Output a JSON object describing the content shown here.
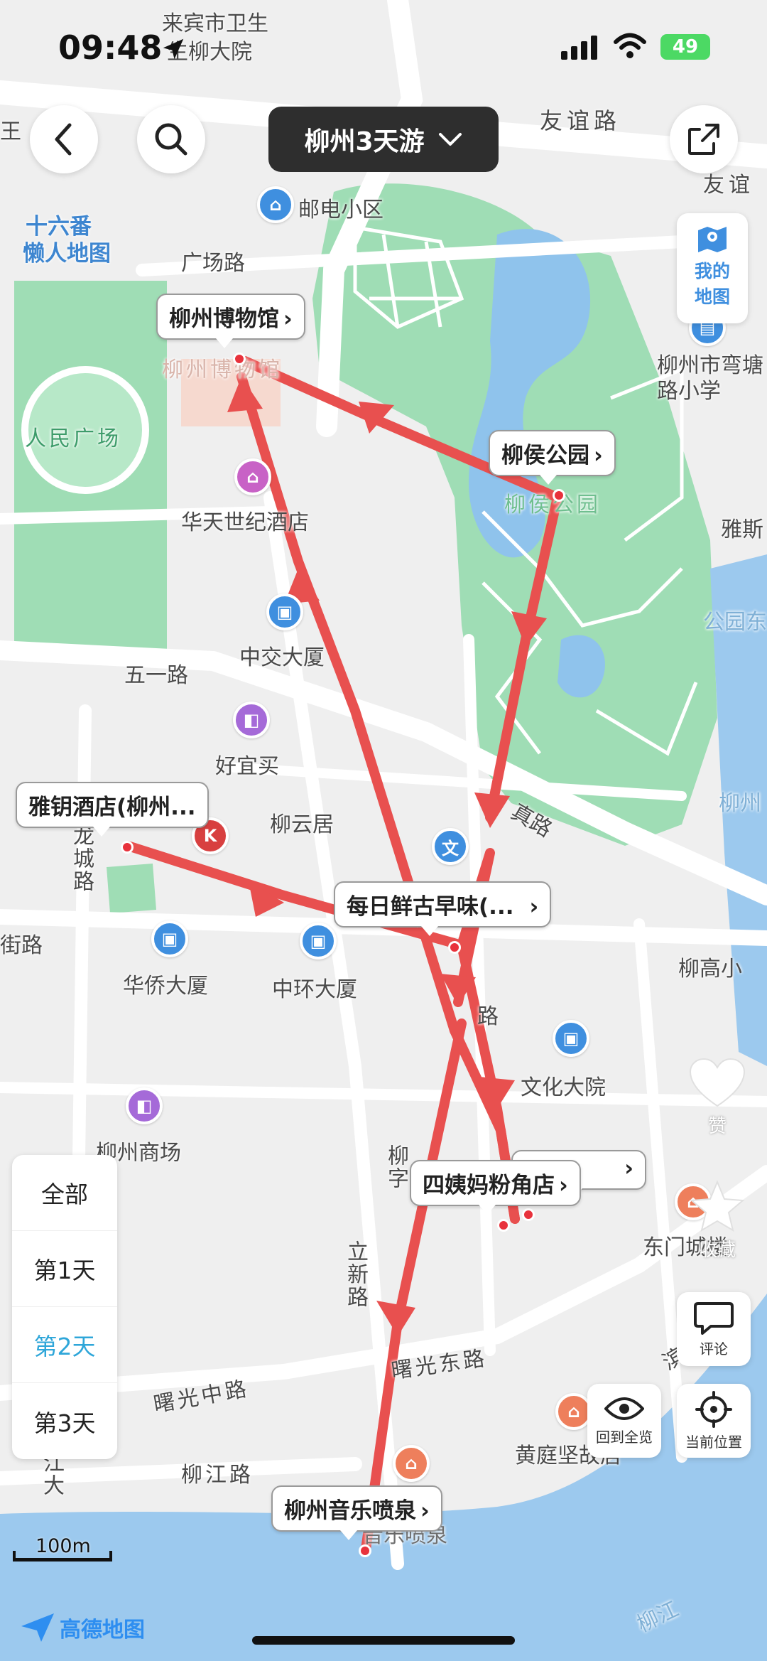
{
  "status_bar": {
    "time": "09:48",
    "battery": "49"
  },
  "header": {
    "title": "柳州3天游"
  },
  "overlay_logo": {
    "line1": "十六番",
    "line2": "懒人地图"
  },
  "my_map": {
    "label_line1": "我的",
    "label_line2": "地图"
  },
  "map_labels": [
    {
      "name": "road-label-youyi",
      "text": "友谊路"
    },
    {
      "name": "road-label-youyi-2",
      "text": "友谊"
    },
    {
      "name": "road-label-guangchang",
      "text": "广场路"
    },
    {
      "name": "road-label-wuyi",
      "text": "五一路"
    },
    {
      "name": "road-label-longcheng",
      "text": "龙城路"
    },
    {
      "name": "road-label-lixin",
      "text": "立新路"
    },
    {
      "name": "road-label-shuguang-east",
      "text": "曙光东路"
    },
    {
      "name": "road-label-shuguang-mid",
      "text": "曙光中路"
    },
    {
      "name": "road-label-liujiang-road",
      "text": "柳江路"
    },
    {
      "name": "road-label-liujiang-river",
      "text": "柳江大"
    },
    {
      "name": "road-label-liujiang-water",
      "text": "柳江"
    },
    {
      "name": "road-label-jie",
      "text": "街路"
    },
    {
      "name": "road-label-zhen",
      "text": "真路"
    },
    {
      "name": "road-label-lu",
      "text": "路"
    },
    {
      "name": "road-label-bin",
      "text": "滨江"
    },
    {
      "name": "area-label-laibin",
      "text": "来宾市卫生"
    },
    {
      "name": "area-label-shengliu",
      "text": "生柳大院"
    },
    {
      "name": "area-label-youdian",
      "text": "邮电小区"
    },
    {
      "name": "area-label-renmin",
      "text": "人民广场"
    },
    {
      "name": "area-label-museum-faded",
      "text": "柳州博物馆"
    },
    {
      "name": "area-label-liuhou-faded",
      "text": "柳侯公园"
    },
    {
      "name": "area-label-huatian",
      "text": "华天世纪酒店"
    },
    {
      "name": "area-label-zhongjiao",
      "text": "中交大厦"
    },
    {
      "name": "area-label-haoyimai",
      "text": "好宜买"
    },
    {
      "name": "area-label-liuyunju",
      "text": "柳云居"
    },
    {
      "name": "area-label-huaqiao",
      "text": "华侨大厦"
    },
    {
      "name": "area-label-zhonghuan",
      "text": "中环大厦"
    },
    {
      "name": "area-label-wenhua",
      "text": "文化大院"
    },
    {
      "name": "area-label-liuzhou-mall",
      "text": "柳州商场"
    },
    {
      "name": "area-label-dongmen",
      "text": "东门城楼"
    },
    {
      "name": "area-label-huangting",
      "text": "黄庭坚故居"
    },
    {
      "name": "area-label-school",
      "text": "柳州市弯塘路小学"
    },
    {
      "name": "area-label-yasi",
      "text": "雅斯"
    },
    {
      "name": "area-label-park-east",
      "text": "公园东"
    },
    {
      "name": "area-label-liugao",
      "text": "柳高小"
    },
    {
      "name": "area-label-liuzhou-east",
      "text": "柳州"
    },
    {
      "name": "area-label-wang",
      "text": "王"
    },
    {
      "name": "area-label-liu-zi",
      "text": "柳字"
    },
    {
      "name": "area-label-fountain-faded",
      "text": "音乐喷泉"
    }
  ],
  "callouts": [
    {
      "name": "museum",
      "text": "柳州博物馆"
    },
    {
      "name": "liuhou-park",
      "text": "柳侯公园"
    },
    {
      "name": "yayue-hotel",
      "text": "雅钥酒店(柳州..."
    },
    {
      "name": "meiri",
      "text": "每日鲜古早味(..."
    },
    {
      "name": "siyima",
      "text": "四姨妈粉角店"
    },
    {
      "name": "fountain",
      "text": "柳州音乐喷泉"
    }
  ],
  "right_panel": {
    "like_label": "赞",
    "collect_label": "收藏",
    "comment_label": "评论"
  },
  "day_selector": {
    "items": [
      "全部",
      "第1天",
      "第2天",
      "第3天"
    ],
    "active_index": 2
  },
  "bottom_buttons": {
    "overview": "回到全览",
    "location": "当前位置"
  },
  "scale": {
    "label": "100m"
  },
  "brand": {
    "text": "高德地图"
  },
  "colors": {
    "route": "#e8504f",
    "accent": "#2ea6d9",
    "park": "#9fddb5",
    "water": "#9cc9ee",
    "title_bg": "#2e2e2e"
  }
}
